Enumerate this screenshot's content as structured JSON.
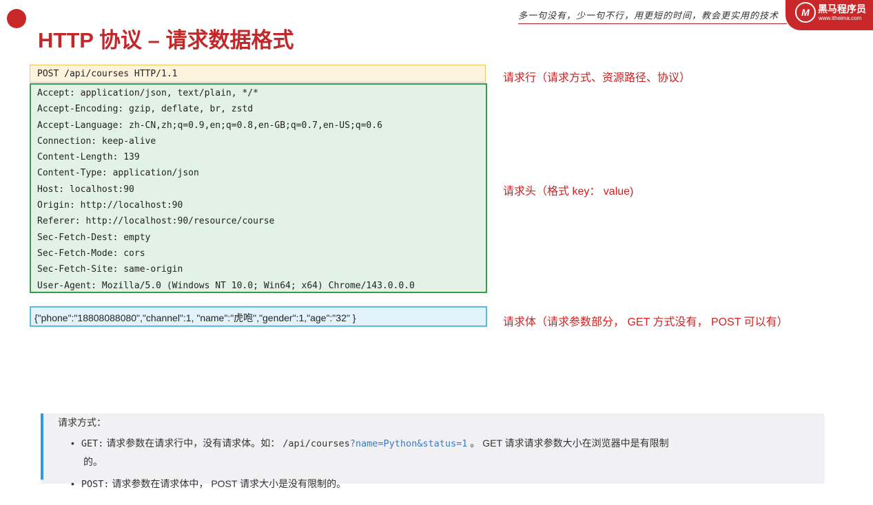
{
  "header": {
    "slogan": "多一句没有，少一句不行，用更短的时间，教会更实用的技术",
    "logo_mark": "M",
    "logo_name": "黑马程序员",
    "logo_url": "www.itheima.com"
  },
  "title": "HTTP 协议 – 请求数据格式",
  "request_line": "POST /api/courses HTTP/1.1",
  "headers": [
    "Accept: application/json, text/plain, */*",
    "Accept-Encoding: gzip, deflate, br, zstd",
    "Accept-Language: zh-CN,zh;q=0.9,en;q=0.8,en-GB;q=0.7,en-US;q=0.6",
    "Connection: keep-alive",
    "Content-Length: 139",
    "Content-Type: application/json",
    "Host: localhost:90",
    "Origin: http://localhost:90",
    "Referer: http://localhost:90/resource/course",
    "Sec-Fetch-Dest: empty",
    "Sec-Fetch-Mode: cors",
    "Sec-Fetch-Site: same-origin",
    "User-Agent: Mozilla/5.0 (Windows NT 10.0; Win64; x64) Chrome/143.0.0.0"
  ],
  "request_body": "{\"phone\":\"18808088080\",\"channel\":1, \"name\":\"虎咆\",\"gender\":1,\"age\":\"32\" }",
  "annotations": {
    "line": "请求行（请求方式、资源路径、协议）",
    "headers": "请求头（格式 key： value)",
    "body": "请求体（请求参数部分， GET 方式没有， POST 可以有）"
  },
  "note": {
    "title": "请求方式：",
    "get_label": "GET:",
    "get_text1": "请求参数在请求行中，没有请求体。如：",
    "get_code_path": "/api/courses",
    "get_code_query": "?name=Python&status=1",
    "get_text2": "。 GET 请求请求参数大小在浏览器中是有限制",
    "get_text3": "的。",
    "post_label": "POST:",
    "post_text": "请求参数在请求体中， POST 请求大小是没有限制的。"
  },
  "colors": {
    "accent": "#c0282a",
    "annotation": "#d02020",
    "line_box_border": "#f0c45a",
    "header_box_border": "#3a9a4a",
    "body_box_border": "#5bbad9",
    "note_bar": "#2b9ce0"
  }
}
